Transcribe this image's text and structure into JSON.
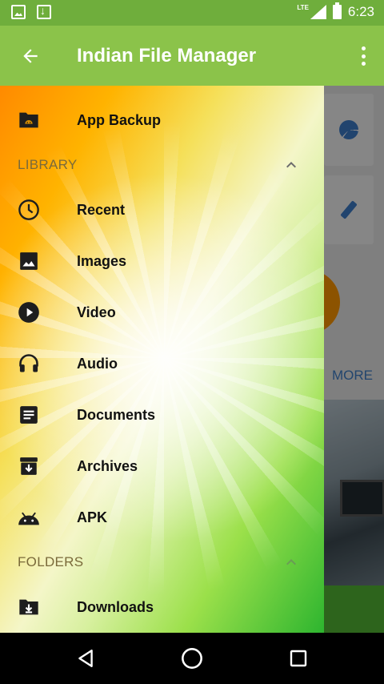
{
  "status_bar": {
    "network": "LTE",
    "time": "6:23",
    "icons": [
      "image-notification-icon",
      "download-notification-icon",
      "signal-icon",
      "battery-icon"
    ]
  },
  "toolbar": {
    "title": "Indian File Manager",
    "back_icon": "arrow-back-icon",
    "overflow_icon": "more-vert-icon"
  },
  "drawer": {
    "top_item": {
      "label": "App Backup",
      "icon": "android-folder-icon"
    },
    "library": {
      "title": "LIBRARY",
      "expanded": true,
      "items": [
        {
          "label": "Recent",
          "icon": "clock-icon"
        },
        {
          "label": "Images",
          "icon": "image-icon"
        },
        {
          "label": "Video",
          "icon": "play-circle-icon"
        },
        {
          "label": "Audio",
          "icon": "headphones-icon"
        },
        {
          "label": "Documents",
          "icon": "document-icon"
        },
        {
          "label": "Archives",
          "icon": "archive-icon"
        },
        {
          "label": "APK",
          "icon": "android-icon"
        }
      ]
    },
    "folders": {
      "title": "FOLDERS",
      "expanded": true,
      "items": [
        {
          "label": "Downloads",
          "icon": "download-folder-icon"
        }
      ]
    }
  },
  "background": {
    "more_label": "MORE"
  },
  "colors": {
    "status_bar": "#6fae3c",
    "toolbar": "#8bc34a",
    "accent_blue": "#3f7fc9",
    "orange": "#ff9800"
  },
  "navigation": {
    "buttons": [
      "back-nav-icon",
      "home-nav-icon",
      "recents-nav-icon"
    ]
  }
}
